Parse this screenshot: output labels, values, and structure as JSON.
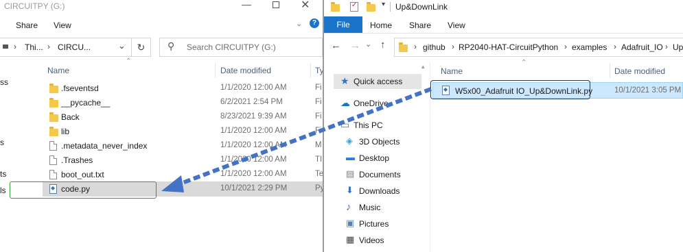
{
  "left_window": {
    "title": "CIRCUITPY (G:)",
    "ribbon": [
      "Share",
      "View"
    ],
    "address": {
      "part1": "Thi...",
      "part2": "CIRCU..."
    },
    "search_placeholder": "Search CIRCUITPY (G:)",
    "columns": {
      "name": "Name",
      "date": "Date modified",
      "type_partial": "Ty"
    },
    "nav_fragments": [
      "ss",
      "s",
      "ts",
      "ls"
    ],
    "files": [
      {
        "name": ".fseventsd",
        "date": "1/1/2020 12:00 AM",
        "type": "Fi",
        "icon": "folder-icon"
      },
      {
        "name": "__pycache__",
        "date": "6/2/2021 2:54 PM",
        "type": "Fi",
        "icon": "folder-icon"
      },
      {
        "name": "Back",
        "date": "8/23/2021 9:39 AM",
        "type": "Fi",
        "icon": "folder-icon"
      },
      {
        "name": "lib",
        "date": "1/1/2020 12:00 AM",
        "type": "Fi",
        "icon": "folder-icon"
      },
      {
        "name": ".metadata_never_index",
        "date": "1/1/2020 12:00 AM",
        "type": "M",
        "icon": "file-icon"
      },
      {
        "name": ".Trashes",
        "date": "1/1/2020 12:00 AM",
        "type": "TI",
        "icon": "file-icon"
      },
      {
        "name": "boot_out.txt",
        "date": "1/1/2020 12:00 AM",
        "type": "Te",
        "icon": "file-icon"
      },
      {
        "name": "code.py",
        "date": "10/1/2021 2:29 PM",
        "type": "Py",
        "icon": "python-file-icon"
      }
    ]
  },
  "right_window": {
    "title": "Up&DownLink",
    "ribbon": {
      "file": "File",
      "home": "Home",
      "share": "Share",
      "view": "View"
    },
    "breadcrumb": [
      "github",
      "RP2040-HAT-CircuitPython",
      "examples",
      "Adafruit_IO",
      "Up"
    ],
    "columns": {
      "name": "Name",
      "date": "Date modified"
    },
    "nav": [
      {
        "label": "Quick access",
        "icon": "star-icon"
      },
      {
        "label": "OneDrive",
        "icon": "cloud-icon"
      },
      {
        "label": "This PC",
        "icon": "computer-icon"
      },
      {
        "label": "3D Objects",
        "icon": "cube-icon"
      },
      {
        "label": "Desktop",
        "icon": "desktop-icon"
      },
      {
        "label": "Documents",
        "icon": "documents-icon"
      },
      {
        "label": "Downloads",
        "icon": "download-icon"
      },
      {
        "label": "Music",
        "icon": "music-icon"
      },
      {
        "label": "Pictures",
        "icon": "pictures-icon"
      },
      {
        "label": "Videos",
        "icon": "videos-icon"
      }
    ],
    "files": [
      {
        "name": "W5x00_Adafruit IO_Up&DownLink.py",
        "date": "10/1/2021 3:05 PM",
        "icon": "python-file-icon"
      }
    ]
  },
  "colors": {
    "file_tab": "#1a73c8",
    "arrow": "#4472c4",
    "target_box": "#2e9a3e",
    "source_box": "#1f3f66",
    "selection": "#cce8ff"
  }
}
